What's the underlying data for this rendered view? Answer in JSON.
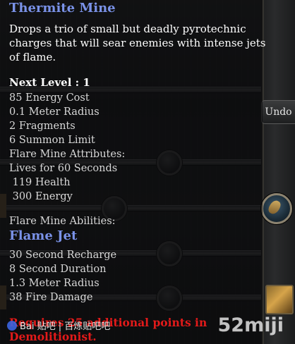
{
  "tooltip": {
    "title": "Thermite Mine",
    "description_lines": [
      "Drops a trio of small but deadly pyrotechnic",
      "charges that will sear enemies with intense jets",
      "of flame."
    ],
    "next_level_label": "Next Level : 1",
    "stats": [
      "85 Energy Cost",
      "0.1 Meter Radius",
      "2 Fragments",
      "6 Summon Limit"
    ],
    "pet_attributes_header": "Flare Mine Attributes:",
    "pet_attributes": [
      "Lives for 60 Seconds",
      " 119 Health",
      " 300 Energy"
    ],
    "pet_abilities_header": "Flare Mine Abilities:",
    "ability_name": "Flame Jet",
    "ability_stats": [
      "30 Second Recharge",
      "8 Second Duration",
      "1.3 Meter Radius",
      "38 Fire Damage"
    ],
    "requirement_lines": [
      "Requires 25 additional points in",
      "Demolitionist."
    ]
  },
  "undo_button": "Undo",
  "watermark_left": "Bai 贴吧 | 百炼贴吧吧",
  "watermark_right": "52miji",
  "colors": {
    "title": "#7a92e8",
    "ability_name": "#7a92e8",
    "requirement": "#e21a1a",
    "stat_text": "#d8d8d8"
  },
  "icons": [
    "thermite-mine-skill-icon",
    "skill-square-icon"
  ]
}
